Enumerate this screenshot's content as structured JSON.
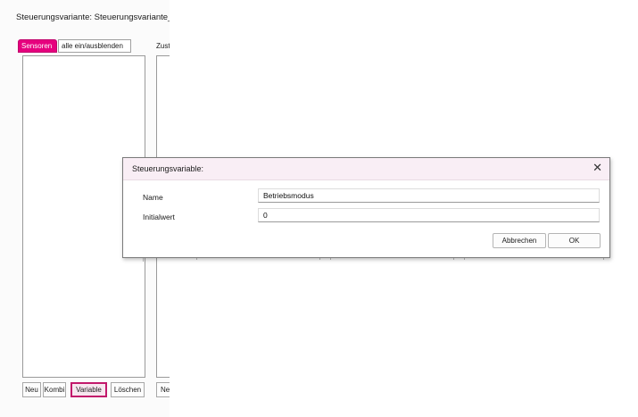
{
  "window": {
    "title": "Steuerungsvariante: Steuerungsvariante_"
  },
  "left_panel": {
    "tabs": {
      "sensoren": "Sensoren",
      "toggle_all": "alle ein/ausblenden"
    },
    "second_header": "Zust",
    "buttons": {
      "neu": "Neu",
      "kombi": "Kombi",
      "variable": "Variable",
      "loeschen": "Löschen",
      "neu2": "Ne"
    }
  },
  "dialog": {
    "title": "Steuerungsvariable:",
    "close_symbol": "✕",
    "fields": {
      "name_label": "Name",
      "name_value": "Betriebsmodus",
      "initial_label": "Initialwert",
      "initial_value": "0"
    },
    "buttons": {
      "cancel": "Abbrechen",
      "ok": "OK"
    }
  },
  "colors": {
    "accent_magenta": "#e6007e",
    "highlight_border": "#c2186b",
    "dialog_titlebar": "#f9eef5"
  }
}
